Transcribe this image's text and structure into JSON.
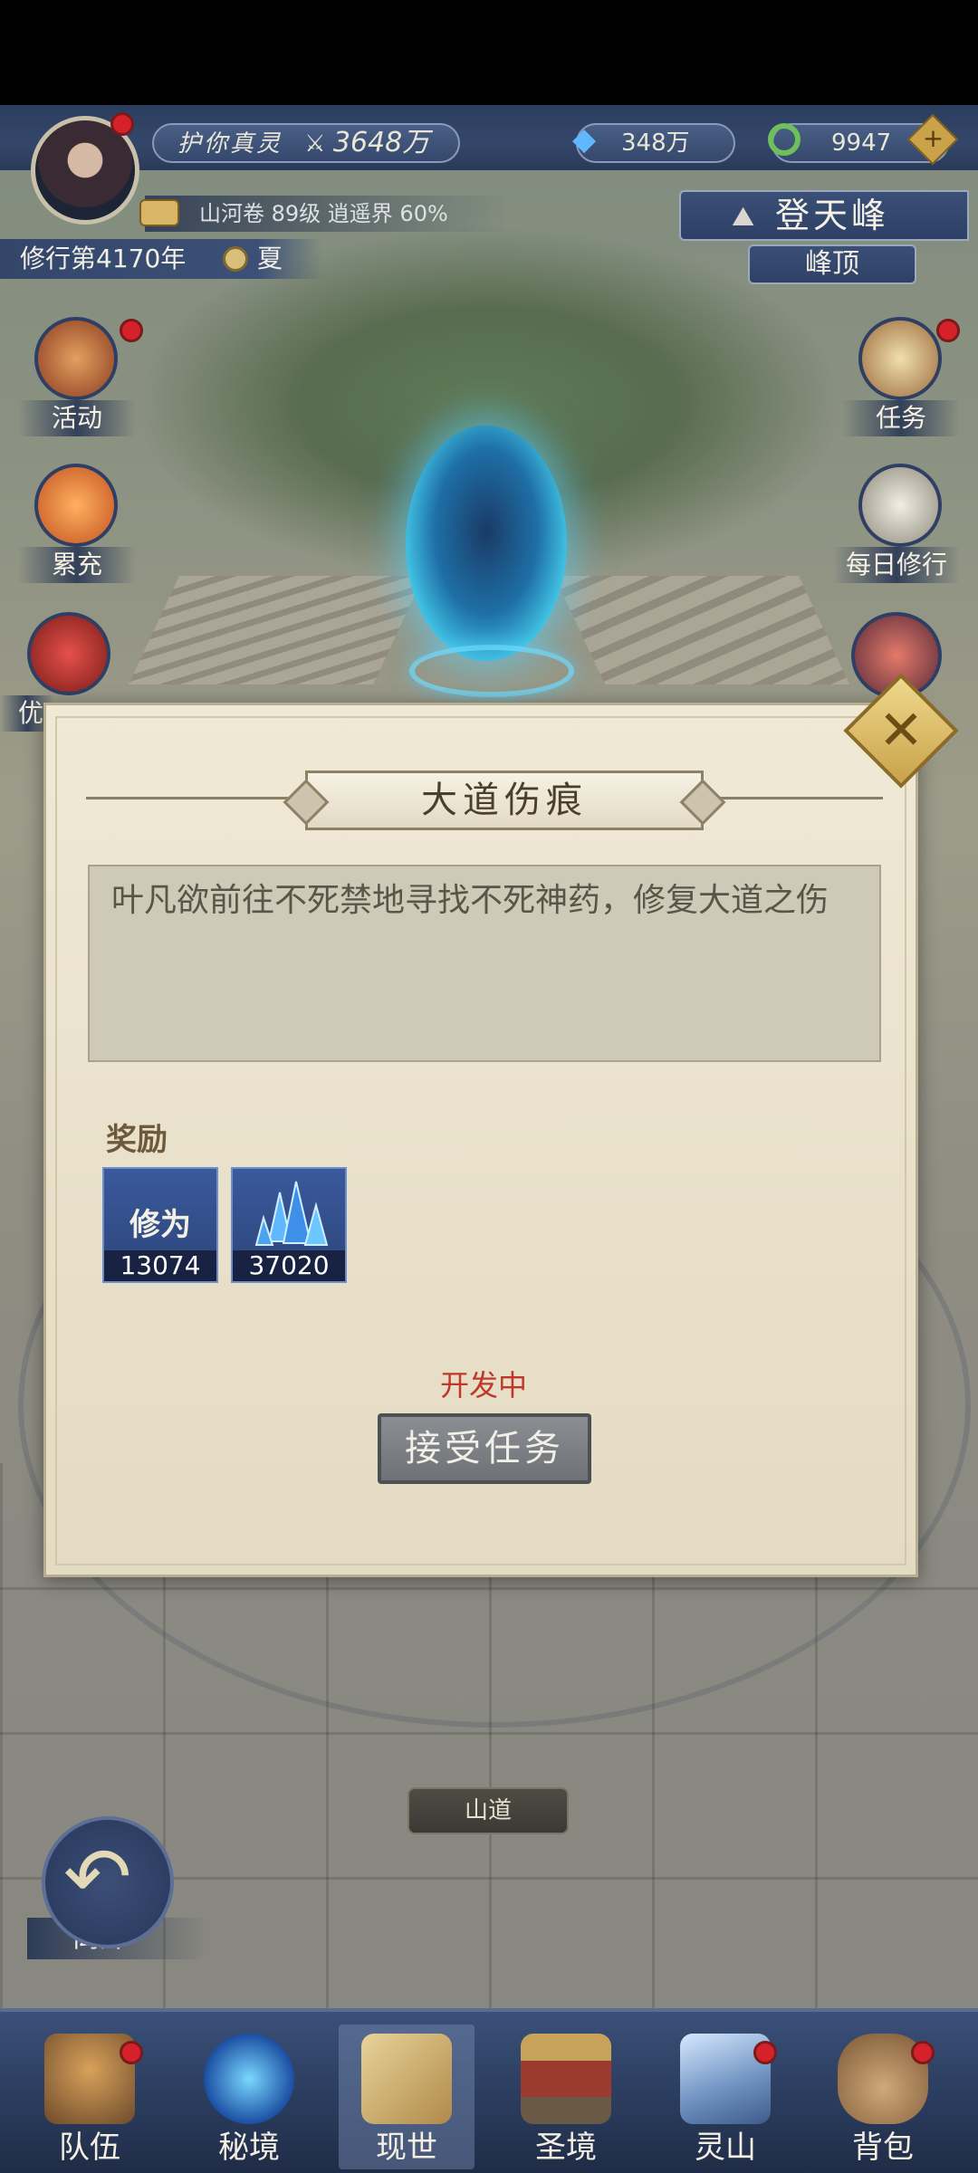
{
  "header": {
    "player_title": "护你真灵",
    "power_value": "3648万",
    "currency_crystal": "348万",
    "currency_jade": "9947",
    "cultivation_info": "山河卷 89级 逍遥界 60%",
    "year_text": "修行第4170年",
    "season": "夏"
  },
  "location": {
    "name": "登天峰",
    "sub": "峰顶"
  },
  "left_menu": [
    {
      "label": "活动",
      "icon": "lantern-icon"
    },
    {
      "label": "累充",
      "icon": "orange-lantern-icon"
    },
    {
      "label": "优",
      "icon": "gift-box-icon"
    }
  ],
  "right_menu": [
    {
      "label": "任务",
      "icon": "scroll-bundle-icon"
    },
    {
      "label": "每日修行",
      "icon": "book-icon"
    }
  ],
  "dialog": {
    "title": "大道伤痕",
    "description": "叶凡欲前往不死禁地寻找不死神药，修复大道之伤",
    "reward_label": "奖励",
    "rewards": [
      {
        "name": "修为",
        "count": "13074",
        "icon": "cultivation-icon"
      },
      {
        "name": "",
        "count": "37020",
        "icon": "crystal-icon"
      }
    ],
    "status_text": "开发中",
    "accept_label": "接受任务",
    "close_symbol": "✕"
  },
  "map": {
    "path_sign": "山道"
  },
  "leave": {
    "label": "离开"
  },
  "bottom_nav": [
    {
      "label": "队伍",
      "icon": "straw-hat-icon"
    },
    {
      "label": "秘境",
      "icon": "vortex-icon"
    },
    {
      "label": "现世",
      "icon": "map-scroll-icon"
    },
    {
      "label": "圣境",
      "icon": "palace-icon"
    },
    {
      "label": "灵山",
      "icon": "mountain-icon"
    },
    {
      "label": "背包",
      "icon": "bag-icon"
    }
  ],
  "colors": {
    "header_blue": "#34476a",
    "dialog_parchment": "#efe9d6",
    "status_red": "#c0372c",
    "close_gold": "#c9a24a"
  }
}
